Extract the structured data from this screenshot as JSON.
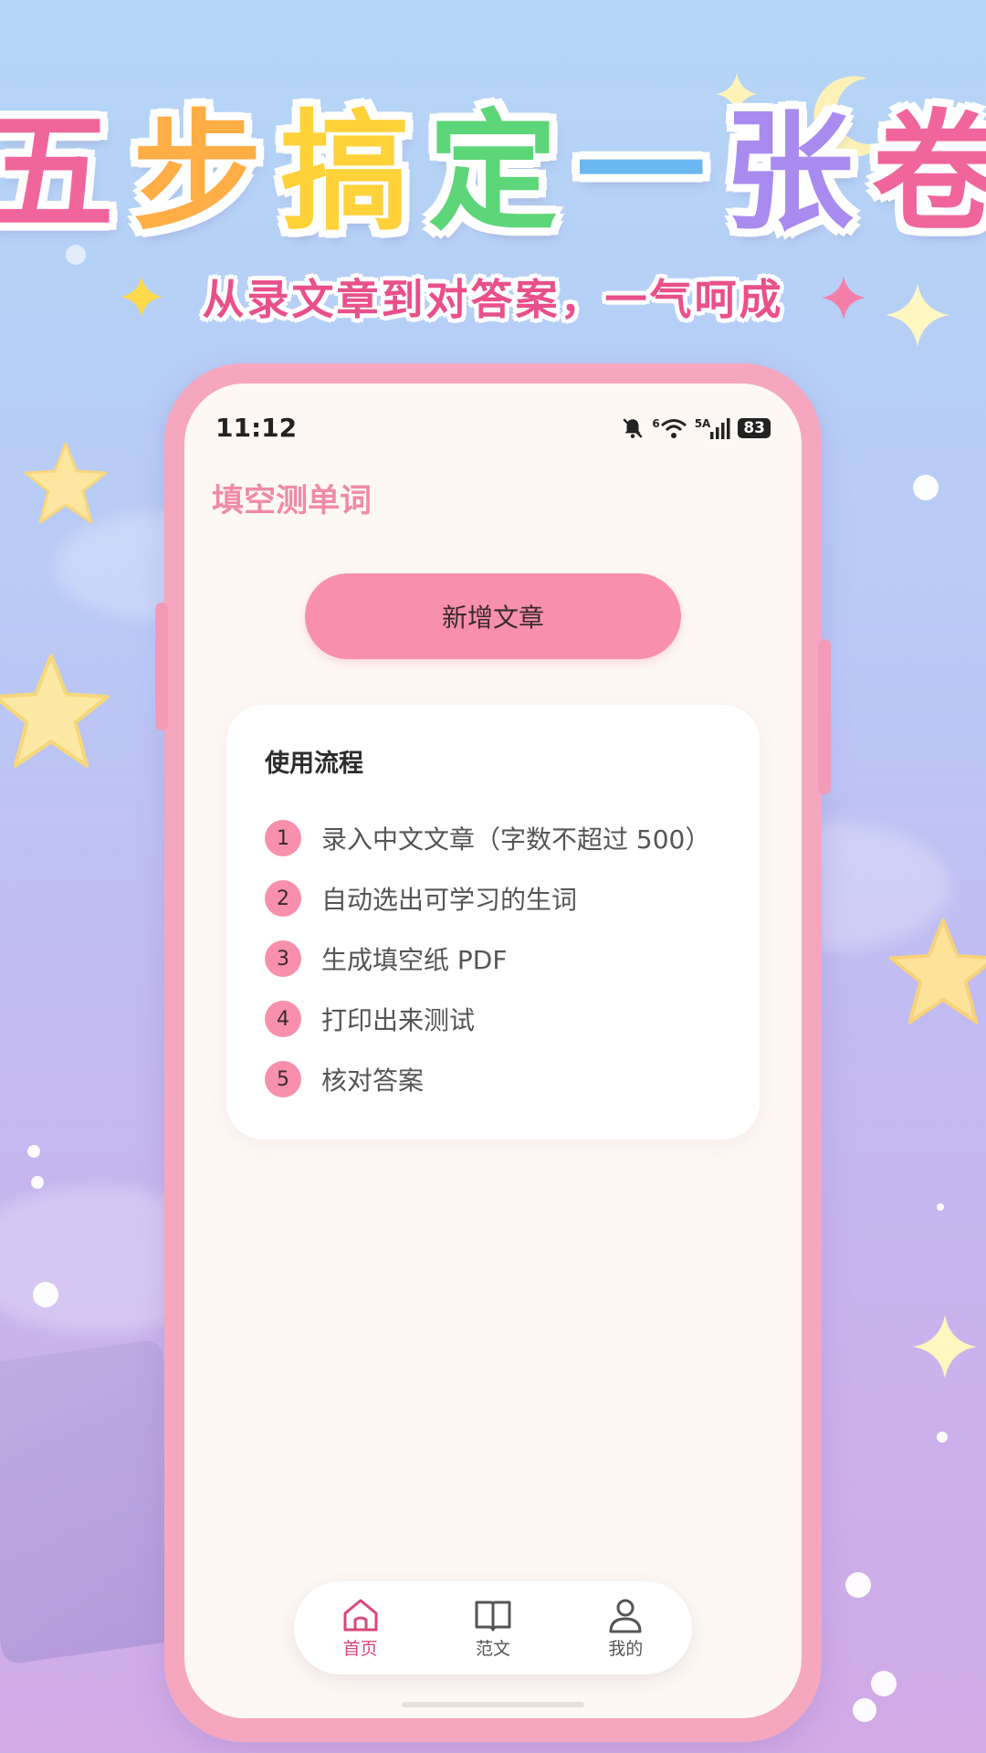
{
  "banner": {
    "headline_chars": [
      {
        "char": "五",
        "color": "#f0669c"
      },
      {
        "char": "步",
        "color": "#ffad45"
      },
      {
        "char": "搞",
        "color": "#ffd23a"
      },
      {
        "char": "定",
        "color": "#5dd67a"
      },
      {
        "char": "一",
        "color": "#6ab7f2"
      },
      {
        "char": "张",
        "color": "#a98bf0"
      },
      {
        "char": "卷",
        "color": "#f0669c"
      }
    ],
    "subtitle": "从录文章到对答案，一气呵成",
    "subtitle_color": "#e9508a"
  },
  "status_bar": {
    "time": "11:12",
    "network_label": "6",
    "signal_label": "5A",
    "battery": "83"
  },
  "app": {
    "title": "填空测单词",
    "primary_button": "新增文章",
    "accent": "#f890ad",
    "usage_card": {
      "title": "使用流程",
      "steps": [
        {
          "num": "1",
          "text": "录入中文文章（字数不超过 500）"
        },
        {
          "num": "2",
          "text": "自动选出可学习的生词"
        },
        {
          "num": "3",
          "text": "生成填空纸 PDF"
        },
        {
          "num": "4",
          "text": "打印出来测试"
        },
        {
          "num": "5",
          "text": "核对答案"
        }
      ]
    },
    "tabs": [
      {
        "label": "首页",
        "icon": "home-icon",
        "active": true
      },
      {
        "label": "范文",
        "icon": "book-icon",
        "active": false
      },
      {
        "label": "我的",
        "icon": "person-icon",
        "active": false
      }
    ]
  }
}
